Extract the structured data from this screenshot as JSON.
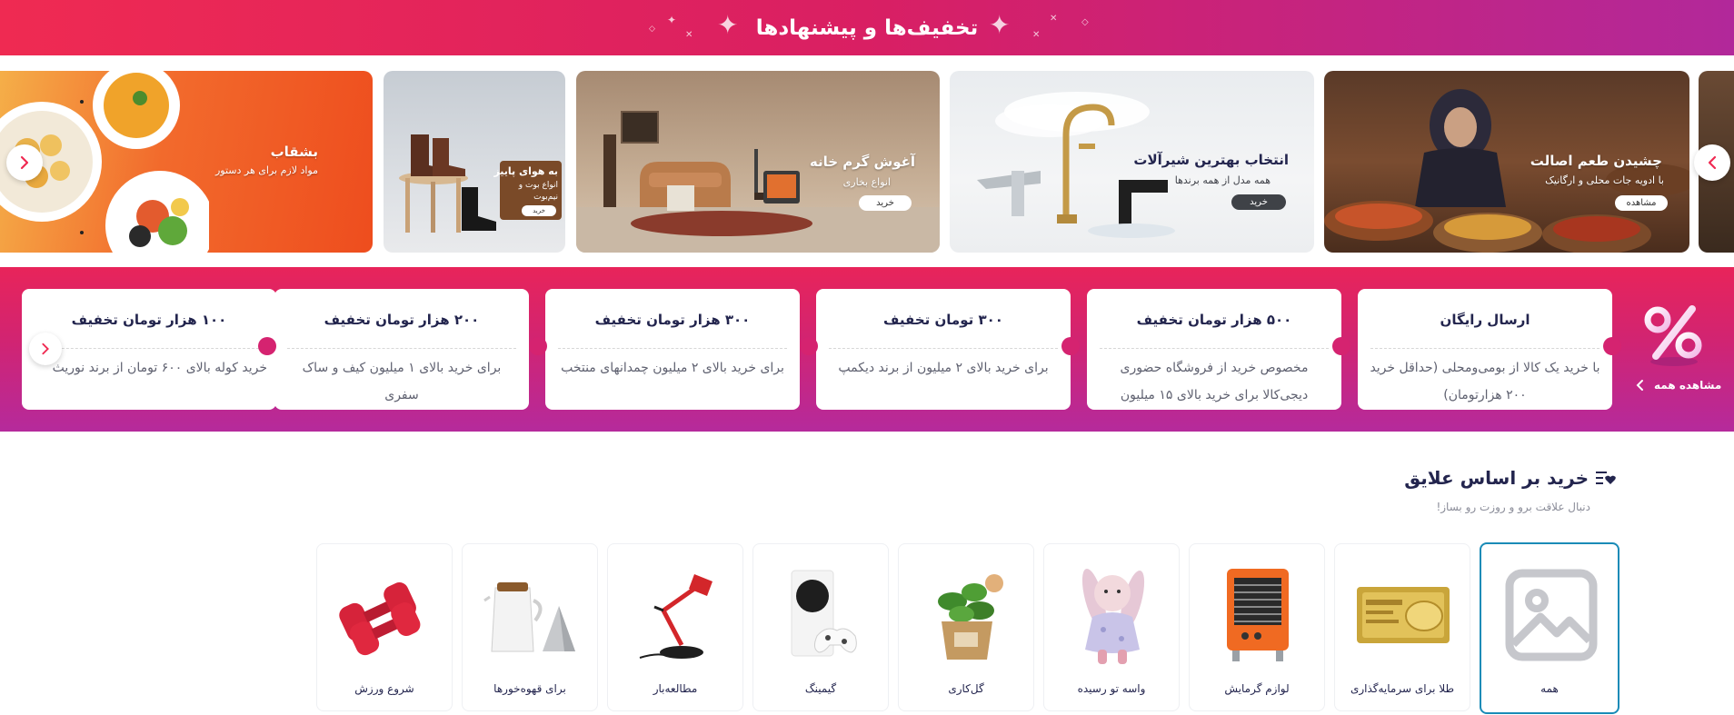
{
  "header": {
    "title": "تخفیف‌ها و پیشنهادها"
  },
  "banners": [
    {
      "title": "چشیدن طعم اصالت",
      "subtitle": "با ادویه جات محلی و ارگانیک",
      "button": "مشاهده"
    },
    {
      "title": "انتخاب بهترین شیرآلات",
      "subtitle": "همه مدل از همه برندها",
      "button": "خرید"
    },
    {
      "title": "آغوش گرم خانه",
      "subtitle": "انواع بخاری",
      "button": "خرید"
    },
    {
      "title": "به هوای پاییز",
      "subtitle": "انواع بوت و نیم‌بوت",
      "button": "خرید"
    },
    {
      "title": "بشقاب",
      "subtitle": "مواد لازم برای هر دستور"
    }
  ],
  "coupons": {
    "see_all": "مشاهده همه",
    "items": [
      {
        "title": "ارسال رایگان",
        "desc": "با خرید یک کالا از بومی‌ومحلی (حداقل خرید ۲۰۰ هزارتومان)"
      },
      {
        "title": "۵۰۰ هزار تومان تخفیف",
        "desc": "مخصوص خرید از فروشگاه حضوری دیجی‌کالا برای خرید بالای ۱۵ میلیون"
      },
      {
        "title": "۳۰۰ تومان تخفیف",
        "desc": "برای خرید بالای ۲ میلیون از برند دیکمپ"
      },
      {
        "title": "۳۰۰ هزار تومان تخفیف",
        "desc": "برای خرید بالای ۲ میلیون چمدانهای منتخب"
      },
      {
        "title": "۲۰۰ هزار تومان تخفیف",
        "desc": "برای خرید بالای ۱ میلیون کیف و ساک سفری"
      },
      {
        "title": "۱۰۰ هزار تومان تخفیف",
        "desc": "خرید کوله بالای ۶۰۰ تومان از برند نوریث"
      }
    ]
  },
  "interests": {
    "title": "خرید بر اساس علایق",
    "subtitle": "دنبال علاقت برو و روزت رو بساز!",
    "categories": [
      {
        "label": "همه",
        "icon": "image-placeholder-icon"
      },
      {
        "label": "طلا برای سرمایه‌گذاری",
        "icon": "gold-bar-icon"
      },
      {
        "label": "لوازم گرمایش",
        "icon": "heater-icon"
      },
      {
        "label": "واسه تو رسیده",
        "icon": "plush-doll-icon"
      },
      {
        "label": "گل‌کاری",
        "icon": "potted-plant-icon"
      },
      {
        "label": "گیمینگ",
        "icon": "game-console-icon"
      },
      {
        "label": "مطالعه‌بار",
        "icon": "desk-lamp-icon"
      },
      {
        "label": "برای قهوه‌خورها",
        "icon": "coffee-kettle-icon"
      },
      {
        "label": "شروع ورزش",
        "icon": "dumbbell-icon"
      }
    ]
  },
  "colors": {
    "brand_pink": "#ef2a52",
    "brand_purple": "#b2289a",
    "active_border": "#1a8bb7"
  }
}
